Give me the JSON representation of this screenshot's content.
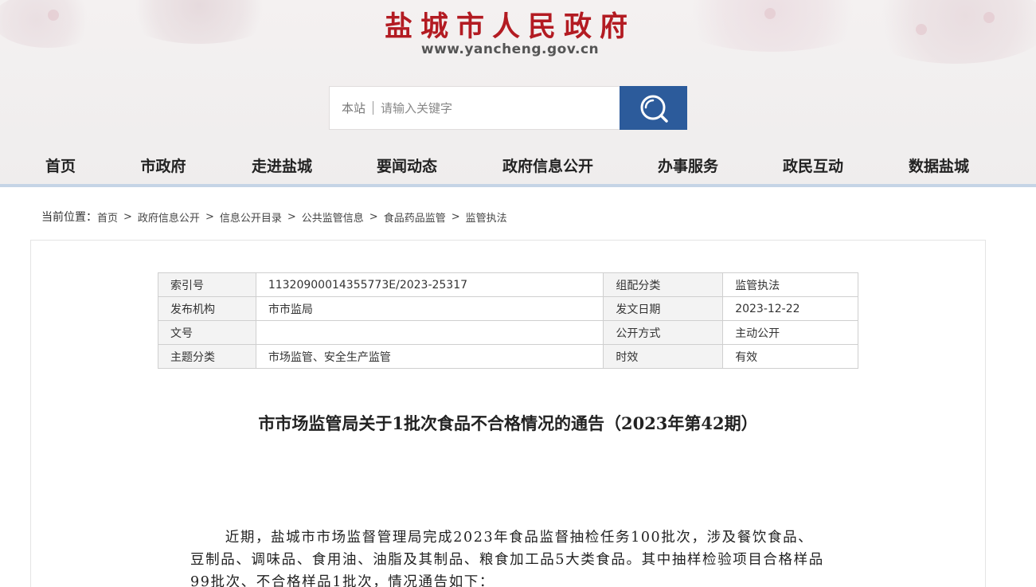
{
  "header": {
    "site_title": "盐城市人民政府",
    "site_url": "www.yancheng.gov.cn",
    "search": {
      "scope": "本站",
      "placeholder": "请输入关键字"
    },
    "search_icon": "magnifier-icon"
  },
  "nav": {
    "items": [
      "首页",
      "市政府",
      "走进盐城",
      "要闻动态",
      "政府信息公开",
      "办事服务",
      "政民互动",
      "数据盐城"
    ]
  },
  "breadcrumb": {
    "label": "当前位置：",
    "items": [
      "首页",
      "政府信息公开",
      "信息公开目录",
      "公共监管信息",
      "食品药品监管",
      "监管执法"
    ],
    "separator": ">"
  },
  "meta": {
    "rows": [
      [
        "索引号",
        "11320900014355773E/2023-25317",
        "组配分类",
        "监管执法"
      ],
      [
        "发布机构",
        "市市监局",
        "发文日期",
        "2023-12-22"
      ],
      [
        "文号",
        "",
        "公开方式",
        "主动公开"
      ],
      [
        "主题分类",
        "市场监管、安全生产监管",
        "时效",
        "有效"
      ]
    ]
  },
  "article": {
    "title": "市市场监管局关于1批次食品不合格情况的通告（2023年第42期）",
    "paragraph": "近期，盐城市市场监督管理局完成2023年食品监督抽检任务100批次，涉及餐饮食品、豆制品、调味品、食用油、油脂及其制品、粮食加工品5大类食品。其中抽样检验项目合格样品99批次、不合格样品1批次，情况通告如下："
  },
  "colors": {
    "title_red": "#b31b22",
    "search_button_blue": "#2c5b9b",
    "nav_underline": "#c5d4e6"
  }
}
